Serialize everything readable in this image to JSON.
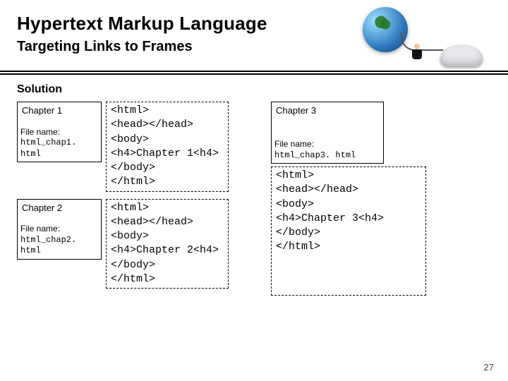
{
  "title": "Hypertext Markup Language",
  "subtitle": "Targeting Links to Frames",
  "solution_label": "Solution",
  "page_number": "27",
  "left": [
    {
      "card_title": "Chapter 1",
      "file_label": "File name:",
      "file_name": "html_chap1. html",
      "code": "<html>\n<head></head>\n<body>\n<h4>Chapter 1<h4>\n</body>\n</html>"
    },
    {
      "card_title": "Chapter 2",
      "file_label": "File name:",
      "file_name": "html_chap2. html",
      "code": "<html>\n<head></head>\n<body>\n<h4>Chapter 2<h4>\n</body>\n</html>"
    }
  ],
  "right": {
    "card_title": "Chapter 3",
    "file_label": "File name:",
    "file_name": "html_chap3. html",
    "code": "<html>\n<head></head>\n<body>\n<h4>Chapter 3<h4>\n</body>\n</html>"
  }
}
